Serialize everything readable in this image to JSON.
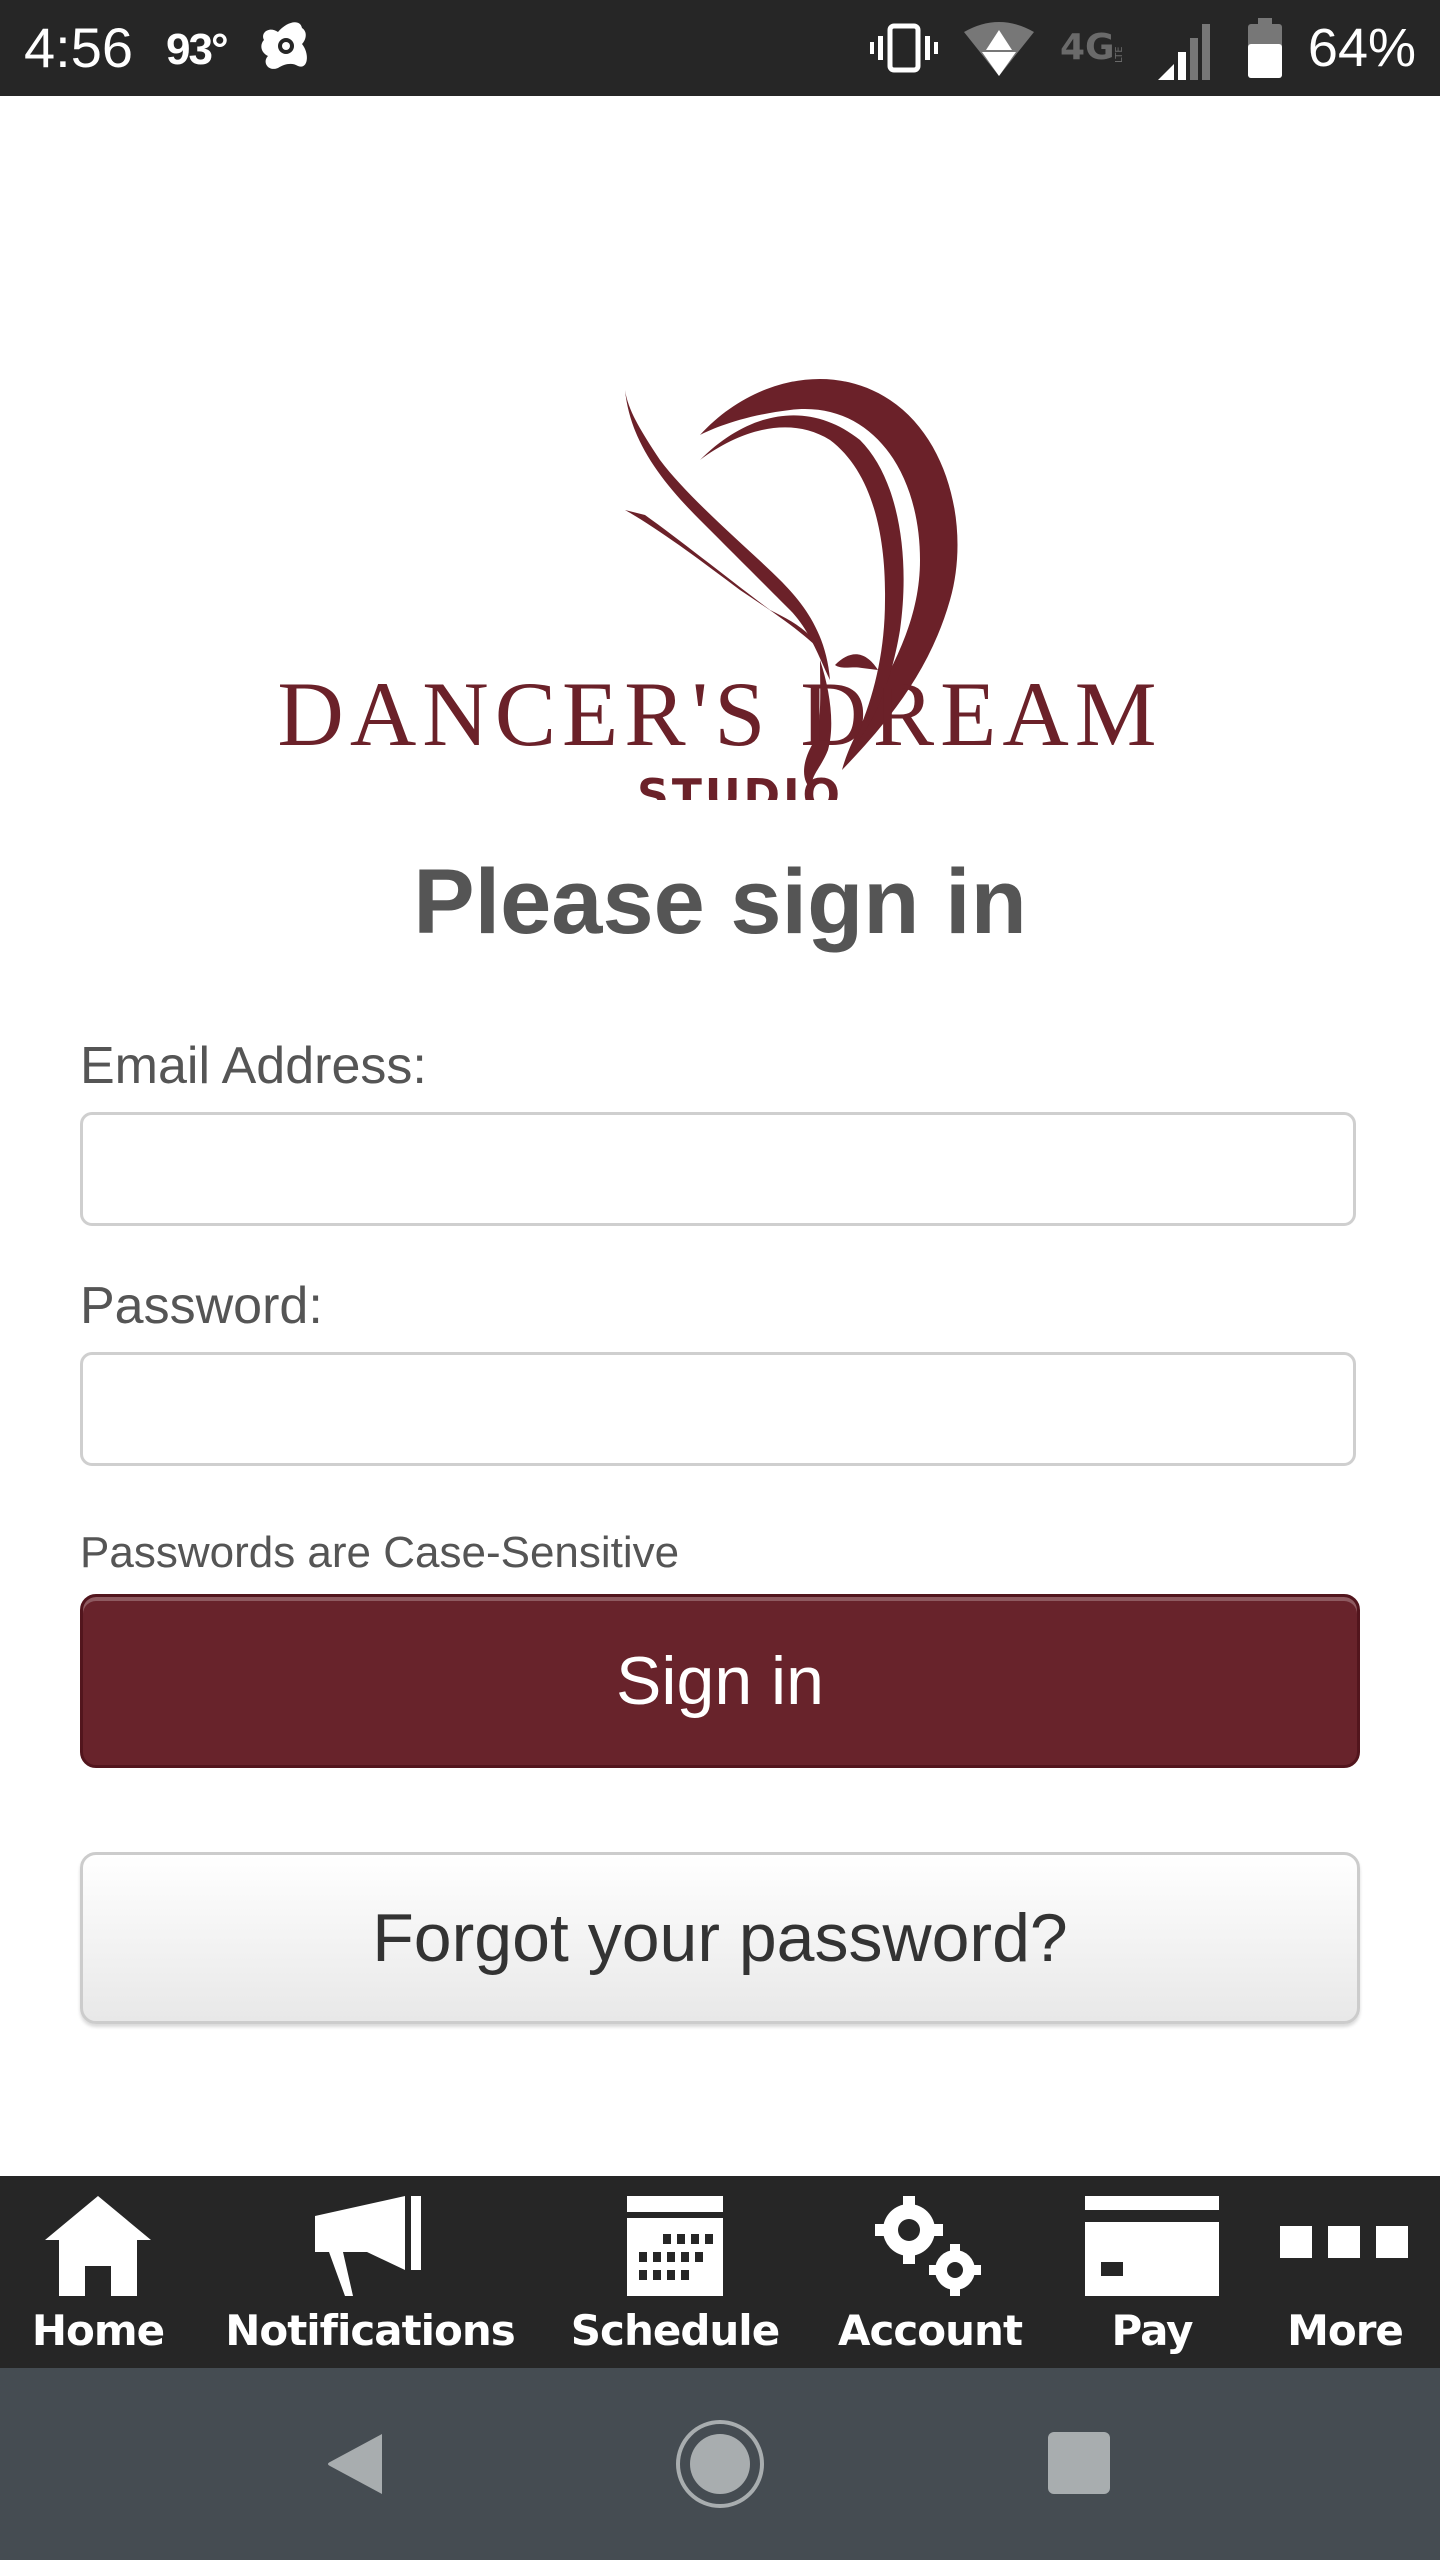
{
  "status_bar": {
    "time": "4:56",
    "temperature": "93°",
    "battery_percent": "64%",
    "icons": [
      "avast-icon",
      "vibrate-icon",
      "wifi-icon",
      "4g-lte-icon",
      "signal-icon",
      "battery-icon"
    ]
  },
  "logo": {
    "brand_name": "DANCER'S DREAM",
    "brand_sub": "STUDIO",
    "color": "#6b2129"
  },
  "page": {
    "title": "Please sign in"
  },
  "form": {
    "email_label": "Email Address:",
    "email_value": "",
    "password_label": "Password:",
    "password_value": "",
    "hint": "Passwords are Case-Sensitive",
    "sign_in_label": "Sign in",
    "forgot_label": "Forgot your password?"
  },
  "colors": {
    "primary": "#68232b",
    "tabbar_bg": "#262626",
    "navbar_bg": "#454c52"
  },
  "tabbar": {
    "items": [
      {
        "label": "Home",
        "icon": "home-icon"
      },
      {
        "label": "Notifications",
        "icon": "megaphone-icon"
      },
      {
        "label": "Schedule",
        "icon": "calendar-icon"
      },
      {
        "label": "Account",
        "icon": "gears-icon"
      },
      {
        "label": "Pay",
        "icon": "credit-card-icon"
      },
      {
        "label": "More",
        "icon": "more-icon"
      }
    ]
  },
  "nav_bar": {
    "buttons": [
      "back",
      "home",
      "recents"
    ]
  }
}
